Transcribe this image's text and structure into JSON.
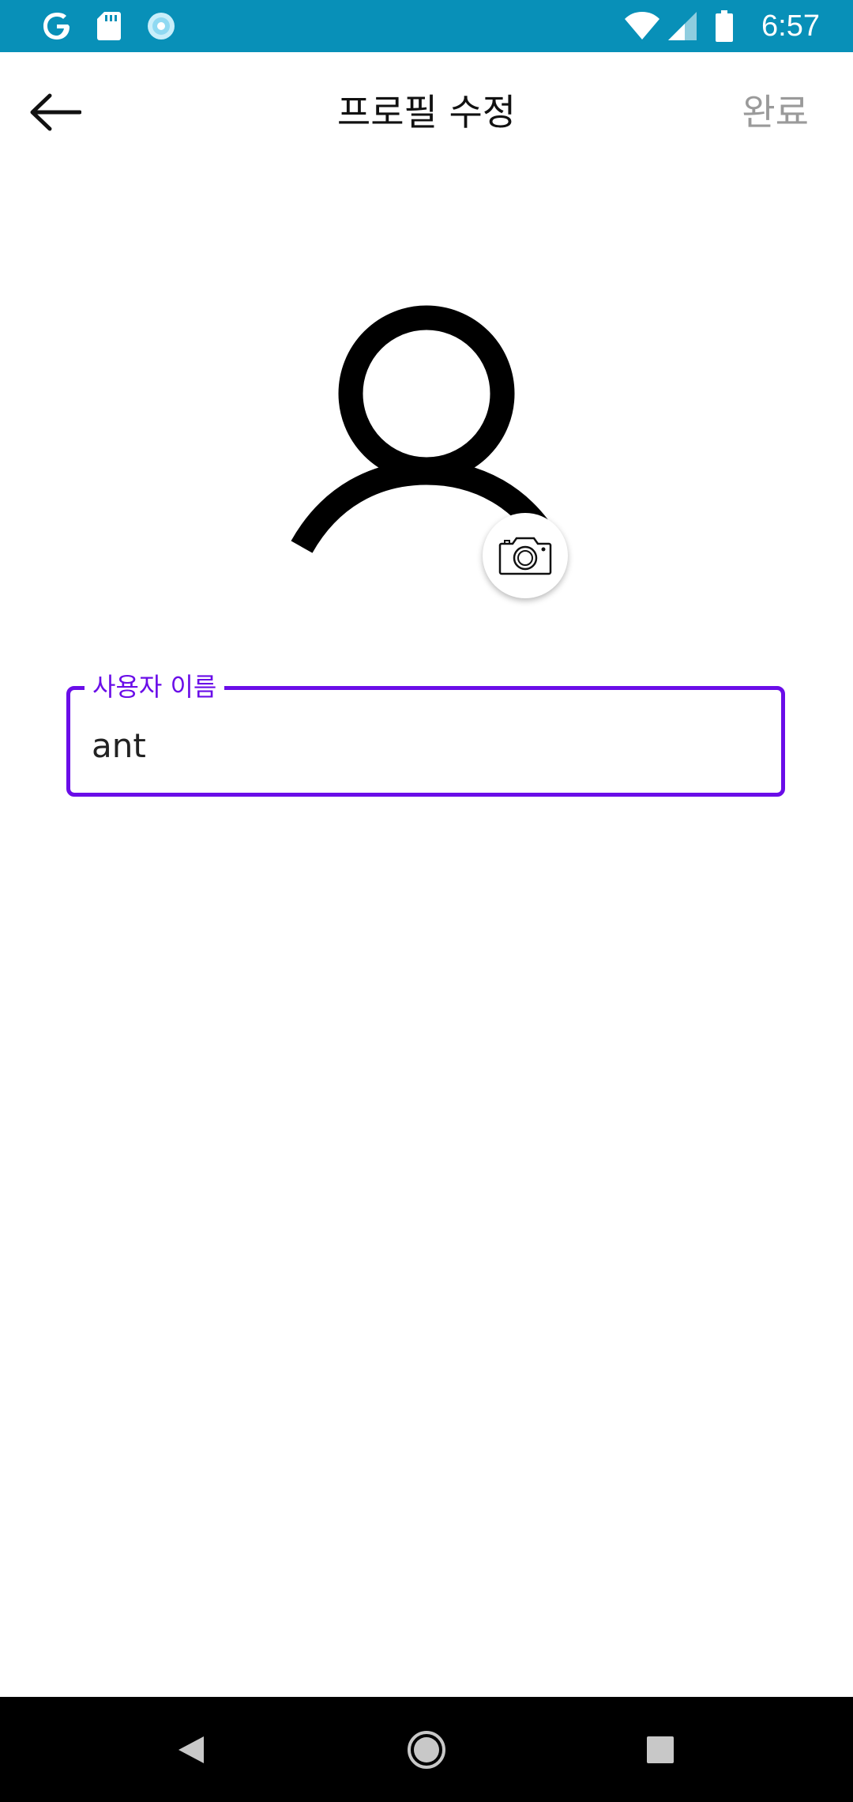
{
  "status_bar": {
    "time": "6:57",
    "background": "#0890b8",
    "icons": [
      "google-icon",
      "sd-card-icon",
      "sync-icon",
      "wifi-icon",
      "signal-icon",
      "battery-icon"
    ]
  },
  "app_bar": {
    "title": "프로필 수정",
    "done_label": "완료",
    "back_icon": "arrow-left-icon"
  },
  "profile": {
    "avatar_icon": "user-icon",
    "camera_icon": "camera-icon"
  },
  "username_field": {
    "label": "사용자 이름",
    "value": "ant",
    "accent_color": "#6a0de8"
  },
  "nav_bar": {
    "icons": [
      "back-triangle-icon",
      "home-circle-icon",
      "recents-square-icon"
    ]
  }
}
